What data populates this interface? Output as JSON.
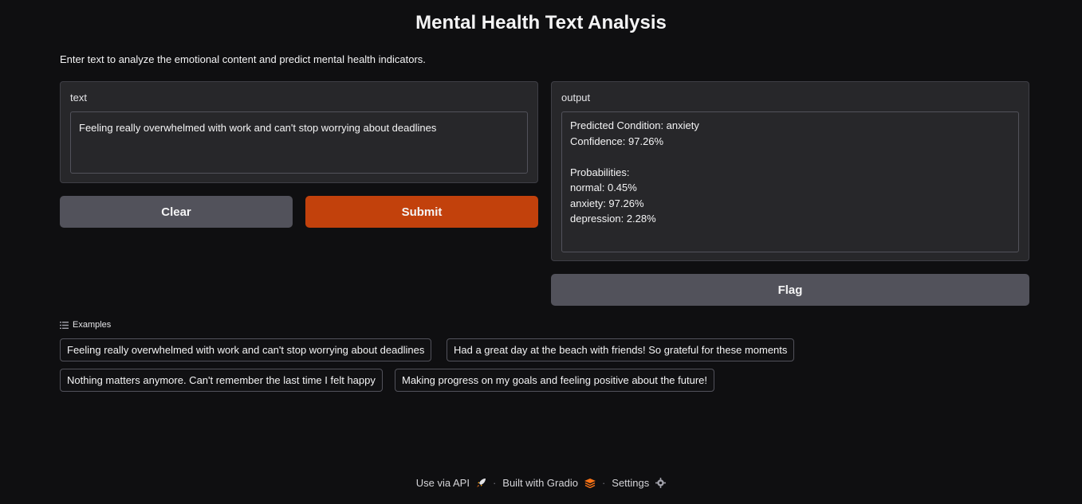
{
  "header": {
    "title": "Mental Health Text Analysis",
    "description": "Enter text to analyze the emotional content and predict mental health indicators."
  },
  "input": {
    "label": "text",
    "value": "Feeling really overwhelmed with work and can't stop worrying about deadlines"
  },
  "buttons": {
    "clear": "Clear",
    "submit": "Submit",
    "flag": "Flag"
  },
  "output": {
    "label": "output",
    "lines": [
      "Predicted Condition: anxiety",
      "Confidence: 97.26%",
      "",
      "Probabilities:",
      "normal: 0.45%",
      "anxiety: 97.26%",
      "depression: 2.28%"
    ]
  },
  "examples": {
    "header": "Examples",
    "items": [
      "Feeling really overwhelmed with work and can't stop worrying about deadlines",
      "Had a great day at the beach with friends! So grateful for these moments",
      "Nothing matters anymore. Can't remember the last time I felt happy",
      "Making progress on my goals and feeling positive about the future!"
    ]
  },
  "footer": {
    "api": "Use via API",
    "built": "Built with Gradio",
    "settings": "Settings",
    "separator": "·"
  },
  "colors": {
    "background": "#0f0f11",
    "primary": "#c2410c",
    "secondary": "#52525b",
    "panel": "#27272a"
  }
}
